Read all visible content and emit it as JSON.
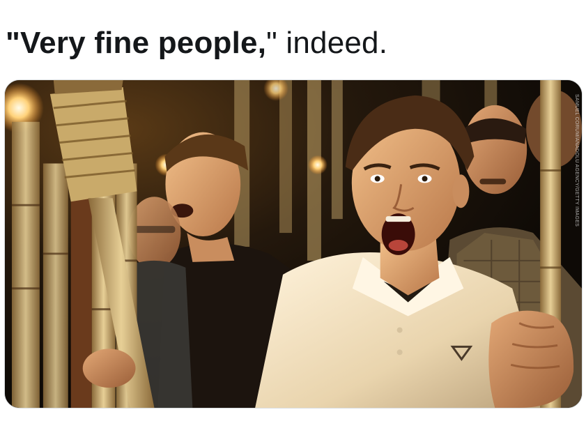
{
  "tweet": {
    "text_bold": "\"Very fine people,",
    "text_rest": "\" indeed."
  },
  "media": {
    "photo_credit": "SAMUEL CORUM/ANADOLU AGENCY/GETTY IMAGES"
  },
  "actions": [
    {
      "name": "reply-icon"
    },
    {
      "name": "retweet-icon"
    },
    {
      "name": "like-icon"
    },
    {
      "name": "share-icon"
    }
  ],
  "colors": {
    "text": "#14171a",
    "icon": "#657786",
    "torch_flame": "#ffd27a",
    "background_dark": "#1a130b"
  }
}
